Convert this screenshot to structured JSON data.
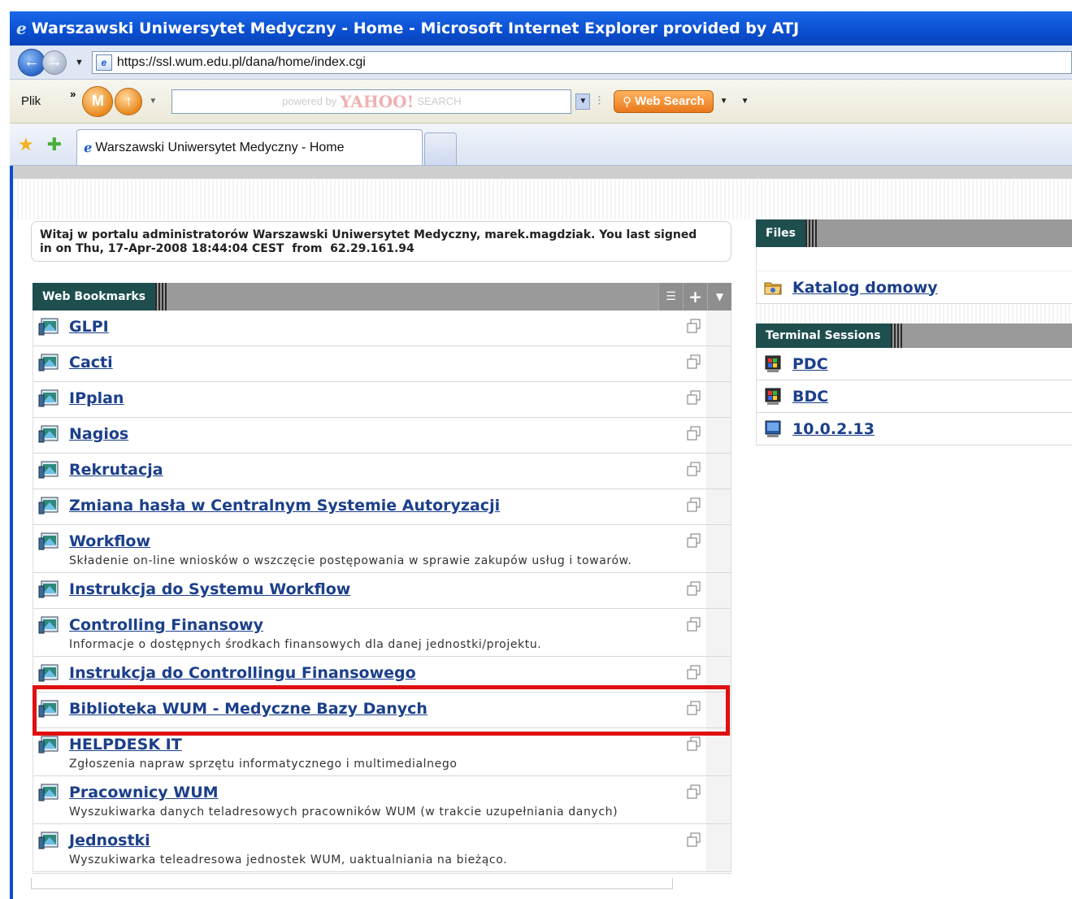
{
  "browser": {
    "title": "Warszawski Uniwersytet Medyczny - Home - Microsoft Internet Explorer provided by ATJ",
    "url": "https://ssl.wum.edu.pl/dana/home/index.cgi",
    "menu_plik": "Plik",
    "chevron": "»",
    "search_placeholder_powered": "powered by",
    "search_placeholder_brand": "YAHOO!",
    "search_placeholder_suffix": "SEARCH",
    "web_search_label": "Web Search",
    "tab_title": "Warszawski Uniwersytet Medyczny - Home",
    "icons": [
      "ie-icon",
      "back-icon",
      "forward-icon",
      "page-icon",
      "m-icon",
      "up-arrow-icon",
      "search-icon",
      "favorites-star-icon",
      "add-favorites-icon"
    ]
  },
  "welcome": {
    "line1": "Witaj w portalu administratorów Warszawski Uniwersytet Medyczny, marek.magdziak. You last signed",
    "line2": "in on Thu, 17-Apr-2008 18:44:04 CEST  from  62.29.161.94"
  },
  "bookmarks": {
    "header": "Web Bookmarks",
    "controls": [
      "list-icon",
      "plus-icon",
      "chevron-down-icon"
    ],
    "items": [
      {
        "label": "GLPI",
        "desc": ""
      },
      {
        "label": "Cacti",
        "desc": ""
      },
      {
        "label": "IPplan",
        "desc": ""
      },
      {
        "label": "Nagios",
        "desc": ""
      },
      {
        "label": "Rekrutacja",
        "desc": ""
      },
      {
        "label": "Zmiana hasła w Centralnym Systemie Autoryzacji",
        "desc": ""
      },
      {
        "label": "Workflow",
        "desc": "Składenie on-line wniosków o wszczęcie postępowania w sprawie zakupów usług i towarów."
      },
      {
        "label": "Instrukcja do Systemu Workflow",
        "desc": ""
      },
      {
        "label": "Controlling Finansowy",
        "desc": "Informacje o dostępnych środkach finansowych dla danej jednostki/projektu."
      },
      {
        "label": "Instrukcja do Controllingu Finansowego",
        "desc": ""
      },
      {
        "label": "Biblioteka WUM - Medyczne Bazy Danych",
        "desc": ""
      },
      {
        "label": "HELPDESK IT",
        "desc": "Zgłoszenia napraw sprzętu informatycznego i multimedialnego"
      },
      {
        "label": "Pracownicy WUM",
        "desc": "Wyszukiwarka danych teladresowych pracowników WUM (w trakcie uzupełniania danych)"
      },
      {
        "label": "Jednostki",
        "desc": "Wyszukiwarka teleadresowa jednostek WUM, uaktualniania na bieżąco."
      }
    ]
  },
  "files": {
    "header": "Files",
    "items": [
      {
        "label": "Katalog domowy",
        "icon": "folder-icon"
      }
    ]
  },
  "terminal": {
    "header": "Terminal Sessions",
    "items": [
      {
        "label": "PDC",
        "icon": "windows-terminal-icon"
      },
      {
        "label": "BDC",
        "icon": "windows-terminal-icon"
      },
      {
        "label": "10.0.2.13",
        "icon": "remote-desktop-icon"
      }
    ]
  },
  "colors": {
    "titlebar": "#0a4ed0",
    "link": "#1b3f8a",
    "panel_header_dark": "#1e4e4e",
    "highlight": "#e01010",
    "web_search": "#e8781c"
  }
}
